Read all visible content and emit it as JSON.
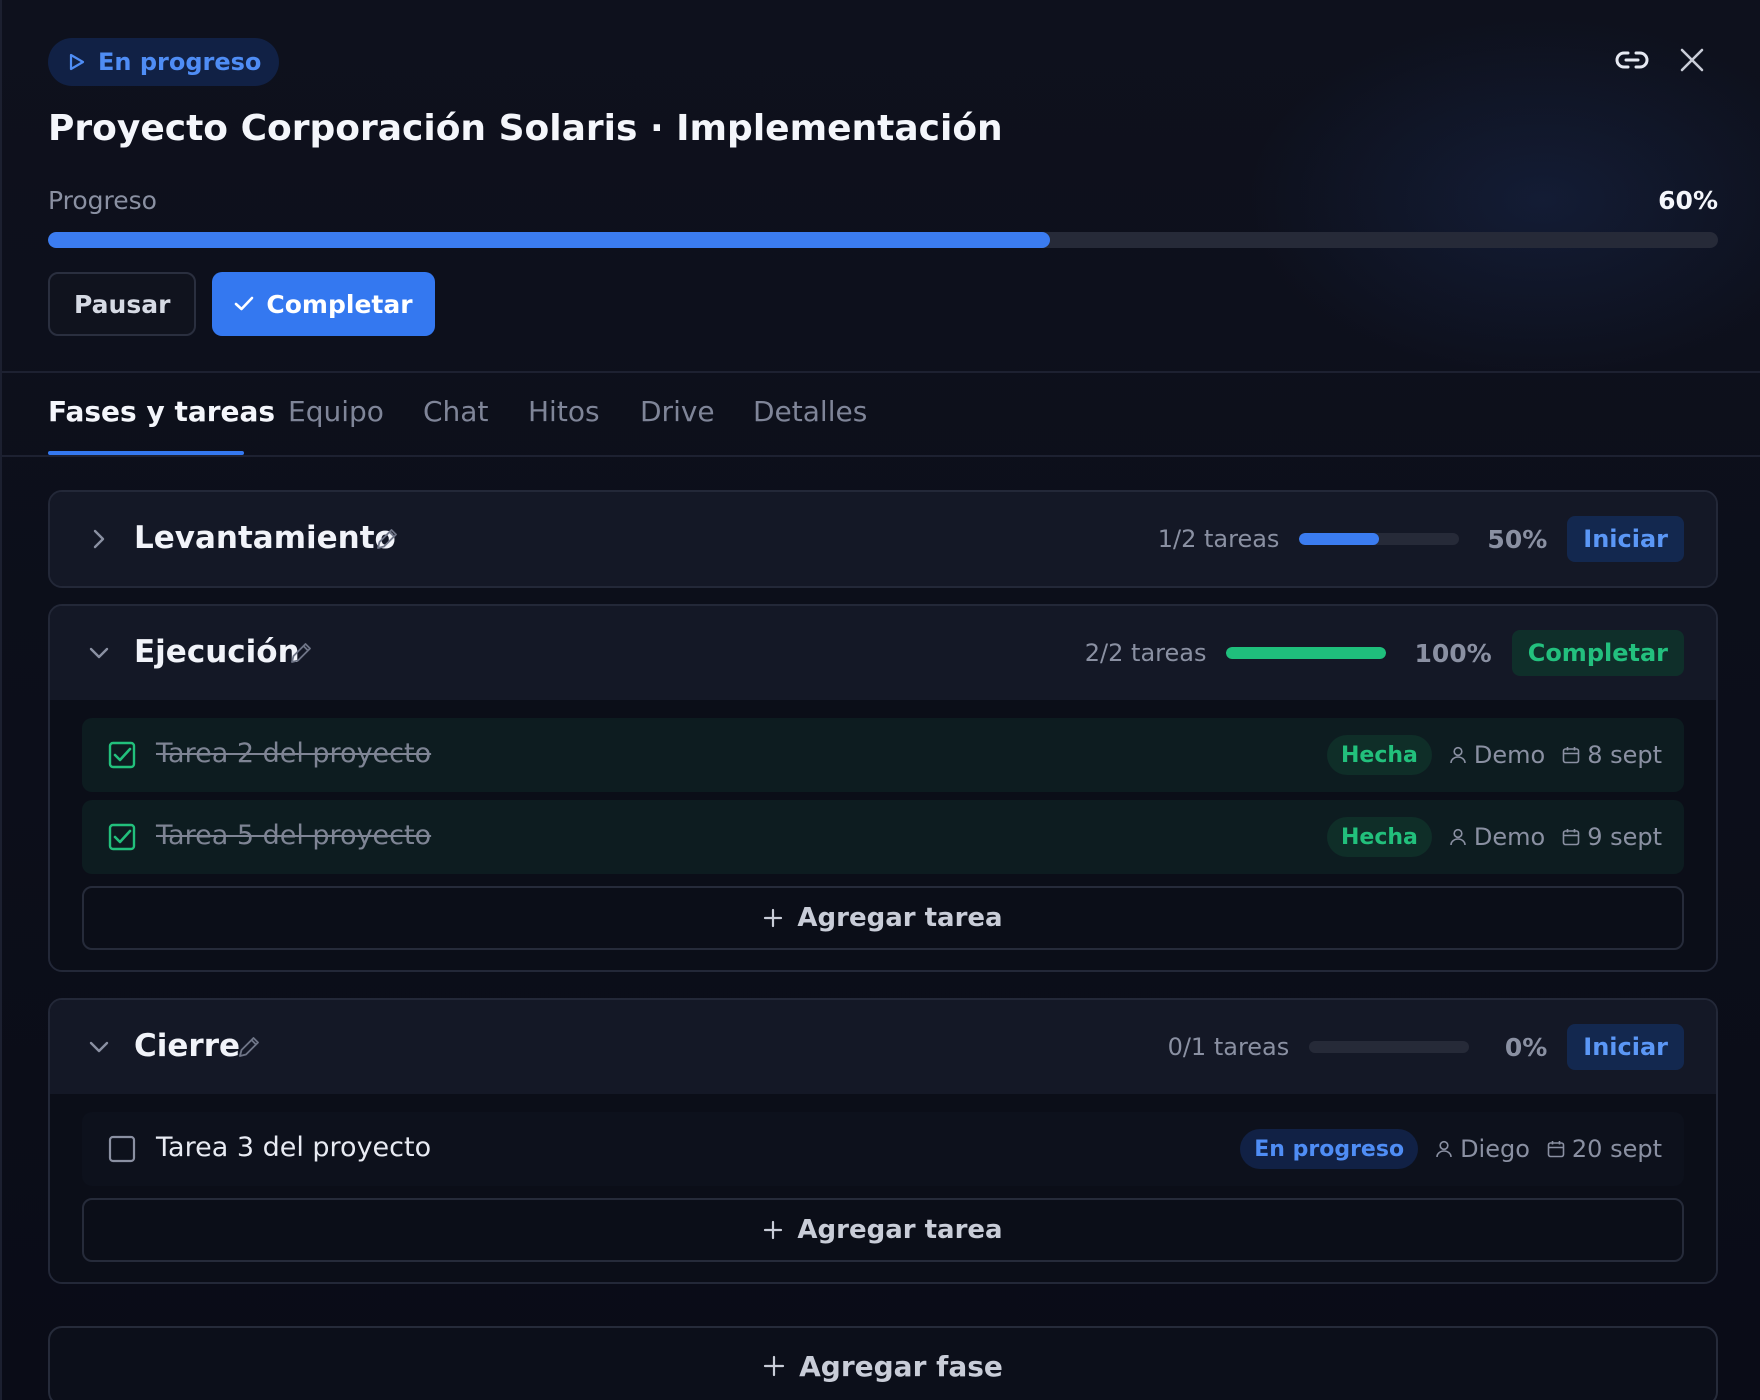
{
  "header": {
    "status": "En progreso",
    "title": "Proyecto Corporación Solaris · Implementación",
    "progress_label": "Progreso",
    "progress_value": "60%",
    "progress_fraction": 0.6,
    "pause_label": "Pausar",
    "complete_label": "Completar"
  },
  "tabs": [
    {
      "label": "Fases y tareas",
      "active": true
    },
    {
      "label": "Equipo",
      "active": false
    },
    {
      "label": "Chat",
      "active": false
    },
    {
      "label": "Hitos",
      "active": false
    },
    {
      "label": "Drive",
      "active": false
    },
    {
      "label": "Detalles",
      "active": false
    }
  ],
  "phases": [
    {
      "name": "Levantamiento",
      "expanded": false,
      "tasks_count": "1/2 tareas",
      "pct": "50%",
      "fraction": 0.5,
      "action": "Iniciar",
      "tasks": []
    },
    {
      "name": "Ejecución",
      "expanded": true,
      "tasks_count": "2/2 tareas",
      "pct": "100%",
      "fraction": 1.0,
      "action": "Completar",
      "tasks": [
        {
          "name": "Tarea 2 del proyecto",
          "status": "Hecha",
          "assignee": "Demo",
          "date": "8 sept",
          "done": true
        },
        {
          "name": "Tarea 5 del proyecto",
          "status": "Hecha",
          "assignee": "Demo",
          "date": "9 sept",
          "done": true
        }
      ],
      "add_task_label": "Agregar tarea"
    },
    {
      "name": "Cierre",
      "expanded": true,
      "tasks_count": "0/1 tareas",
      "pct": "0%",
      "fraction": 0.0,
      "action": "Iniciar",
      "tasks": [
        {
          "name": "Tarea 3 del proyecto",
          "status": "En progreso",
          "assignee": "Diego",
          "date": "20 sept",
          "done": false
        }
      ],
      "add_task_label": "Agregar tarea"
    }
  ],
  "add_phase_label": "Agregar fase",
  "colors": {
    "accent": "#3478f0",
    "success": "#22c07c",
    "background": "#0b0d18"
  },
  "icons": {
    "status": "play-outline-icon",
    "link": "link-icon",
    "close": "close-icon",
    "check": "check-icon",
    "expand": "chevron-right-icon",
    "collapse": "chevron-down-icon",
    "edit": "pencil-icon",
    "assignee": "user-icon",
    "date": "calendar-icon",
    "add": "plus-icon"
  }
}
